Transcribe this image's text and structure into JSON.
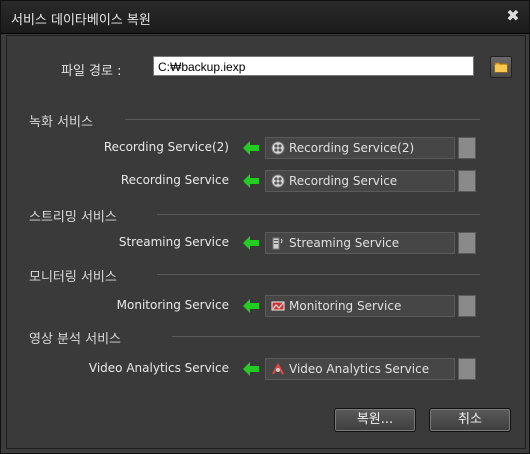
{
  "window": {
    "title": "서비스 데이타베이스 복원",
    "close_glyph": "✖"
  },
  "file": {
    "label": "파일 경로 :",
    "value": "C:₩backup.iexp",
    "browse_icon": "folder-icon"
  },
  "sections": [
    {
      "title": "녹화 서비스",
      "rows": [
        {
          "source": "Recording Service(2)",
          "target": "Recording Service(2)",
          "icon": "film-reel-icon"
        },
        {
          "source": "Recording Service",
          "target": "Recording Service",
          "icon": "film-reel-icon"
        }
      ]
    },
    {
      "title": "스트리밍 서비스",
      "rows": [
        {
          "source": "Streaming Service",
          "target": "Streaming Service",
          "icon": "streaming-server-icon"
        }
      ]
    },
    {
      "title": "모니터링 서비스",
      "rows": [
        {
          "source": "Monitoring Service",
          "target": "Monitoring Service",
          "icon": "monitor-icon"
        }
      ]
    },
    {
      "title": "영상 분석 서비스",
      "rows": [
        {
          "source": "Video Analytics Service",
          "target": "Video Analytics Service",
          "icon": "analytics-icon"
        }
      ]
    }
  ],
  "buttons": {
    "restore": "복원...",
    "cancel": "취소"
  },
  "colors": {
    "arrow": "#22cc22",
    "background": "#3a3a3a",
    "titlebar": "#1f1f1f"
  }
}
